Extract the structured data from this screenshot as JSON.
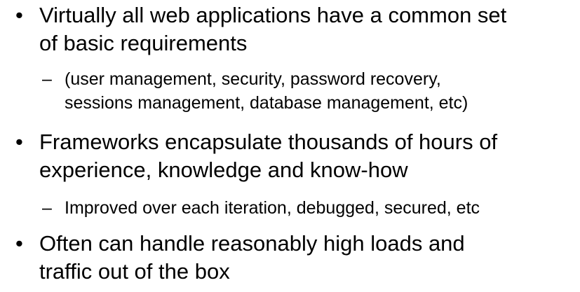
{
  "bullets": [
    {
      "marker": "•",
      "lines": [
        "Virtually all web applications have a common set",
        "of basic requirements"
      ],
      "sub": {
        "marker": "–",
        "lines": [
          "(user management, security, password recovery,",
          "sessions management, database management, etc)"
        ]
      }
    },
    {
      "marker": "•",
      "lines": [
        "Frameworks encapsulate thousands of hours of",
        "experience, knowledge and know-how"
      ],
      "sub": {
        "marker": "–",
        "lines": [
          "Improved over each iteration, debugged, secured, etc"
        ]
      }
    },
    {
      "marker": "•",
      "lines": [
        "Often can handle reasonably high loads and",
        "traffic out of the box"
      ]
    }
  ]
}
